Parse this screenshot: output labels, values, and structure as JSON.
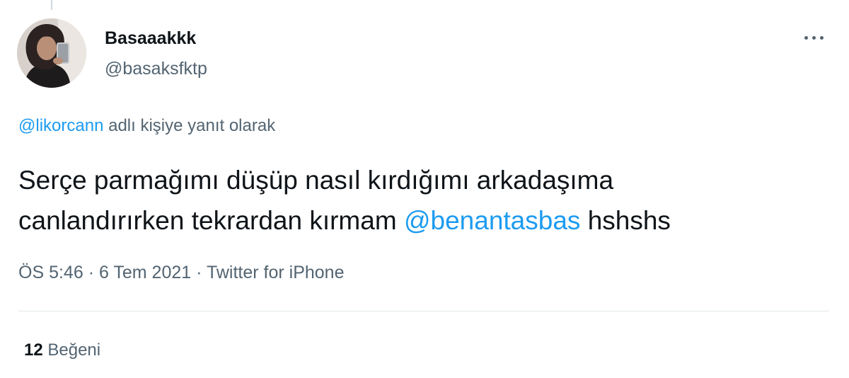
{
  "thread": {
    "has_line_above": true
  },
  "author": {
    "display_name": "Basaaakkk",
    "handle": "@basaksfktp",
    "avatar_icon": "user-avatar"
  },
  "menu": {
    "icon": "more-horizontal-icon"
  },
  "reply_context": {
    "mention": "@likorcann",
    "suffix": "adlı kişiye yanıt olarak"
  },
  "tweet": {
    "line1": "Serçe parmağımı düşüp nasıl kırdığımı arkadaşıma",
    "line2_prefix": "canlandırırken tekrardan kırmam",
    "mention": "@benantasbas",
    "line2_suffix": "hshshs"
  },
  "meta": {
    "time": "ÖS 5:46",
    "separator1": "·",
    "date": "6 Tem 2021",
    "separator2": "·",
    "source": "Twitter for iPhone"
  },
  "stats": {
    "likes_count": "12",
    "likes_label": "Beğeni"
  },
  "colors": {
    "link": "#1d9bf0",
    "text_primary": "#0f1419",
    "text_secondary": "#536471",
    "divider": "#e3e8eb"
  }
}
